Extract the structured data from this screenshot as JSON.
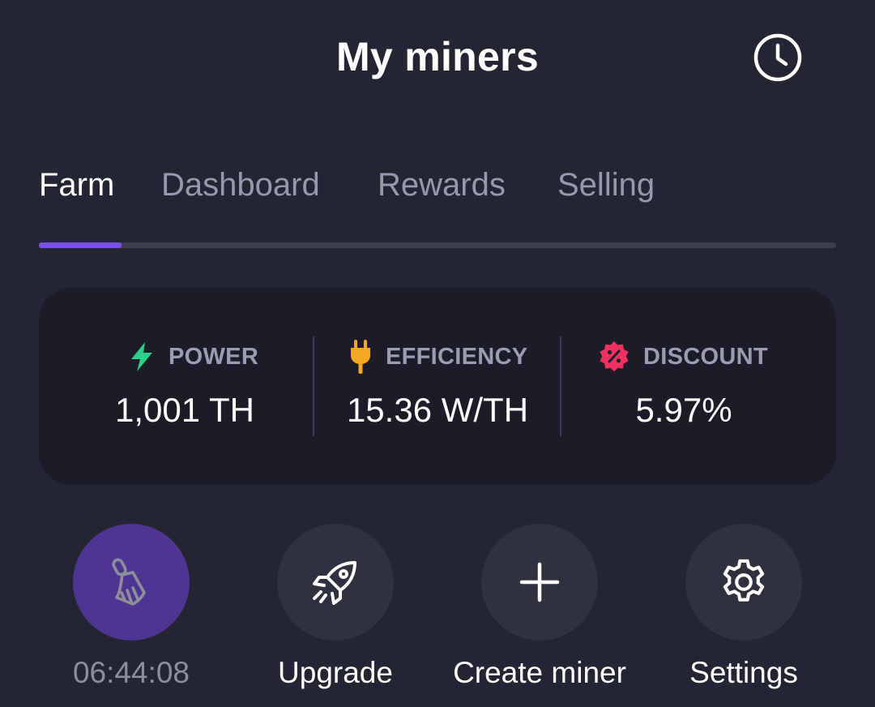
{
  "header": {
    "title": "My miners",
    "history_icon": "clock-icon"
  },
  "tabs": [
    {
      "label": "Farm",
      "active": true
    },
    {
      "label": "Dashboard",
      "active": false
    },
    {
      "label": "Rewards",
      "active": false
    },
    {
      "label": "Selling",
      "active": false
    }
  ],
  "stats": {
    "power": {
      "label": "POWER",
      "value": "1,001 TH",
      "icon": "lightning-icon",
      "icon_color": "#2ecf8a"
    },
    "efficiency": {
      "label": "EFFICIENCY",
      "value": "15.36 W/TH",
      "icon": "plug-icon",
      "icon_color": "#f5a623"
    },
    "discount": {
      "label": "DISCOUNT",
      "value": "5.97%",
      "icon": "discount-badge-icon",
      "icon_color": "#f0315f"
    }
  },
  "actions": {
    "clean": {
      "label": "06:44:08",
      "icon": "broom-icon"
    },
    "upgrade": {
      "label": "Upgrade",
      "icon": "rocket-icon"
    },
    "create": {
      "label": "Create miner",
      "icon": "plus-icon"
    },
    "settings": {
      "label": "Settings",
      "icon": "gear-icon"
    }
  },
  "colors": {
    "background": "#232532",
    "card": "#1b1c28",
    "accent": "#7b4fea",
    "clean_button": "#4e3591",
    "action_button": "#2f313e"
  }
}
